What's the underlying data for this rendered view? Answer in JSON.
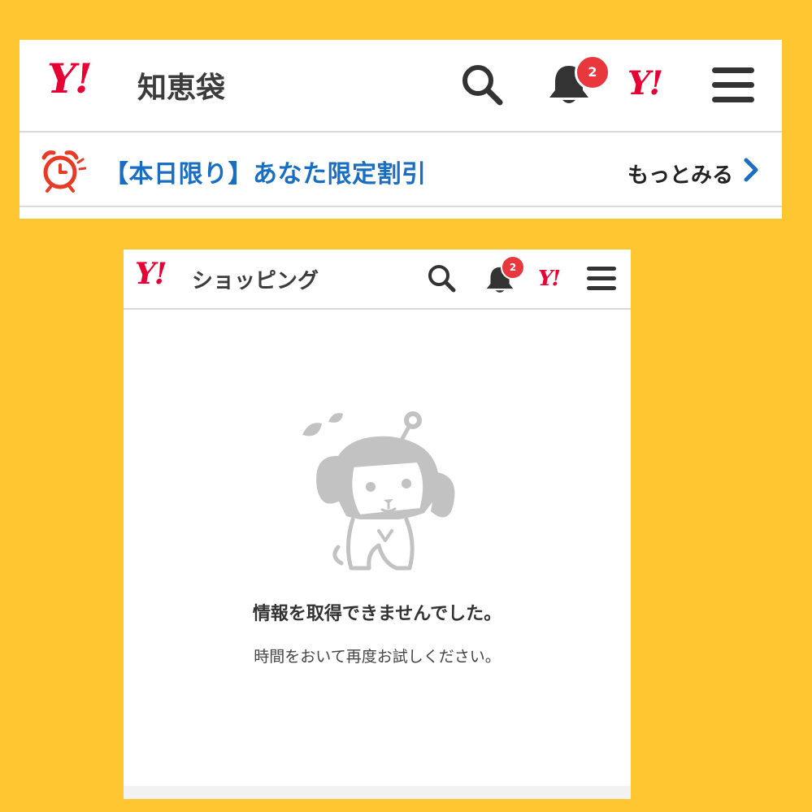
{
  "top_panel": {
    "logo_mark": "Y!",
    "service_name": "知恵袋",
    "notification_count": "2",
    "brand_mark": "Y!",
    "promo_text": "【本日限り】あなた限定割引",
    "more_link": "もっとみる"
  },
  "bottom_panel": {
    "logo_mark": "Y!",
    "service_name": "ショッピング",
    "notification_count": "2",
    "brand_mark": "Y!",
    "error_title": "情報を取得できませんでした。",
    "error_message": "時間をおいて再度お試しください。"
  },
  "colors": {
    "background": "#fec630",
    "brand_red": "#e60033",
    "link_blue": "#1a6ec2",
    "badge_red": "#e8383d"
  },
  "icons": [
    "search-icon",
    "bell-icon",
    "menu-icon",
    "alarm-clock-icon",
    "chevron-right-icon",
    "mascot-illustration"
  ]
}
